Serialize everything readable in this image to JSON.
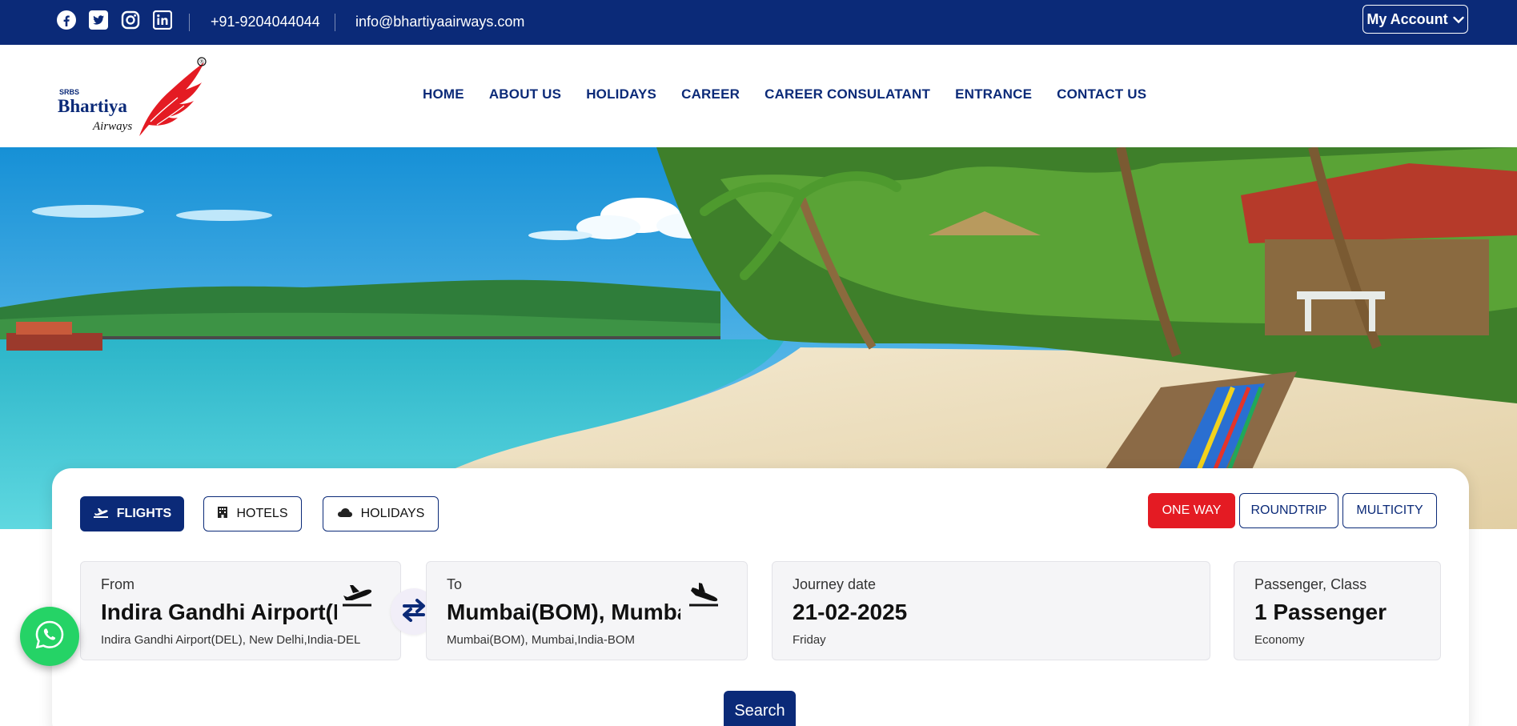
{
  "topbar": {
    "social": [
      {
        "icon": "facebook-icon"
      },
      {
        "icon": "twitter-icon"
      },
      {
        "icon": "instagram-icon"
      },
      {
        "icon": "linkedin-icon"
      }
    ],
    "phone": "+91-9204044044",
    "email": "info@bhartiyaairways.com",
    "account_label": "My Account"
  },
  "logo": {
    "small_text": "SRBS",
    "name": "Bhartiya",
    "script": "Airways",
    "mark": "®"
  },
  "nav": {
    "items": [
      "HOME",
      "ABOUT US",
      "HOLIDAYS",
      "CAREER",
      "CAREER CONSULATANT",
      "ENTRANCE",
      "CONTACT US"
    ]
  },
  "search": {
    "tabs": [
      {
        "label": "FLIGHTS",
        "icon": "plane-icon",
        "active": true
      },
      {
        "label": "HOTELS",
        "icon": "hotel-icon",
        "active": false
      },
      {
        "label": "HOLIDAYS",
        "icon": "cloud-icon",
        "active": false
      }
    ],
    "trip_types": [
      {
        "label": "ONE WAY",
        "active": true
      },
      {
        "label": "ROUNDTRIP",
        "active": false
      },
      {
        "label": "MULTICITY",
        "active": false
      }
    ],
    "from": {
      "label": "From",
      "value": "Indira Gandhi Airport(DEL), New Delhi",
      "detail": "Indira Gandhi Airport(DEL), New Delhi,India-DEL"
    },
    "to": {
      "label": "To",
      "value": "Mumbai(BOM), Mumbai",
      "detail": "Mumbai(BOM), Mumbai,India-BOM"
    },
    "date": {
      "label": "Journey date",
      "value": "21-02-2025",
      "detail": "Friday"
    },
    "passenger": {
      "label": "Passenger, Class",
      "value": "1 Passenger",
      "detail": "Economy"
    },
    "search_label": "Search"
  },
  "colors": {
    "brand_navy": "#0b2a78",
    "accent_red": "#e41b23",
    "whatsapp_green": "#25d366"
  }
}
